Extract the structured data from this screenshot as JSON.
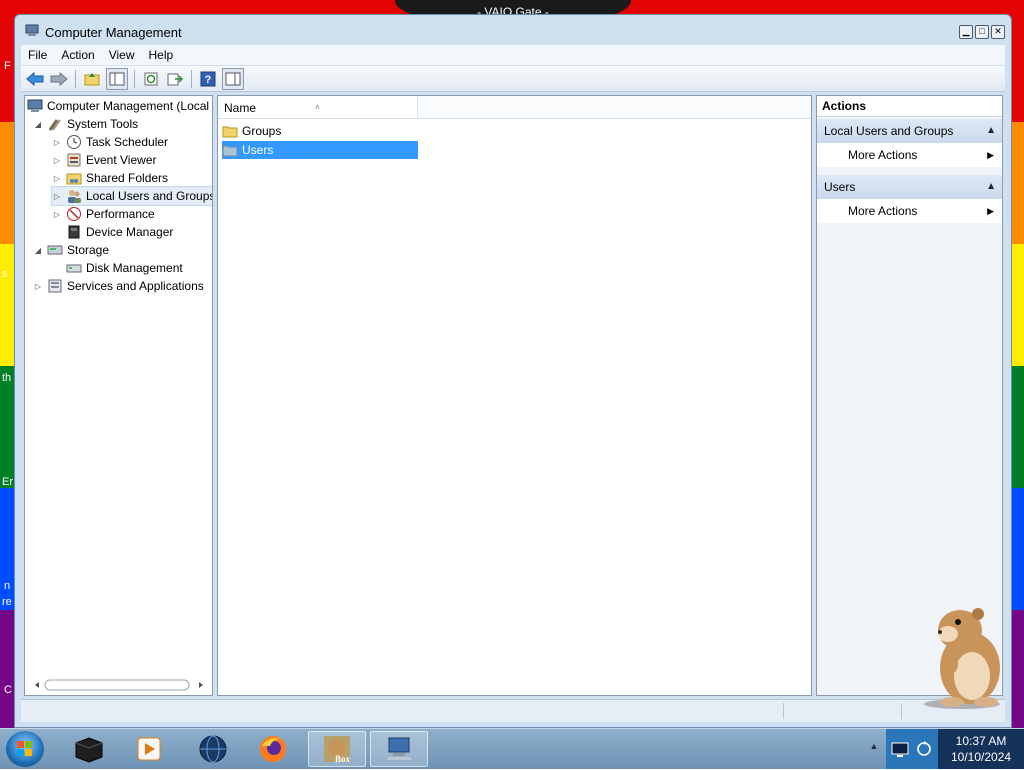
{
  "desktop": {
    "top_badge": "- VAIO Gate -",
    "edge_letters": [
      "F",
      "s",
      "th",
      "Er",
      "n",
      "re",
      "C"
    ]
  },
  "window": {
    "title": "Computer Management"
  },
  "menu": [
    "File",
    "Action",
    "View",
    "Help"
  ],
  "tree": {
    "root": "Computer Management (Local",
    "items": [
      {
        "label": "System Tools"
      },
      {
        "label": "Task Scheduler"
      },
      {
        "label": "Event Viewer"
      },
      {
        "label": "Shared Folders"
      },
      {
        "label": "Local Users and Groups"
      },
      {
        "label": "Performance"
      },
      {
        "label": "Device Manager"
      },
      {
        "label": "Storage"
      },
      {
        "label": "Disk Management"
      },
      {
        "label": "Services and Applications"
      }
    ]
  },
  "list": {
    "column_name": "Name",
    "rows": [
      {
        "label": "Groups"
      },
      {
        "label": "Users"
      }
    ]
  },
  "actions": {
    "header": "Actions",
    "sections": [
      {
        "title": "Local Users and Groups",
        "item": "More Actions"
      },
      {
        "title": "Users",
        "item": "More Actions"
      }
    ]
  },
  "taskbar": {
    "time": "10:37 AM",
    "date": "10/10/2024",
    "box_label": "Box"
  },
  "colors": {
    "selection": "#3399ff",
    "window_frame": "#cfe0f1"
  }
}
